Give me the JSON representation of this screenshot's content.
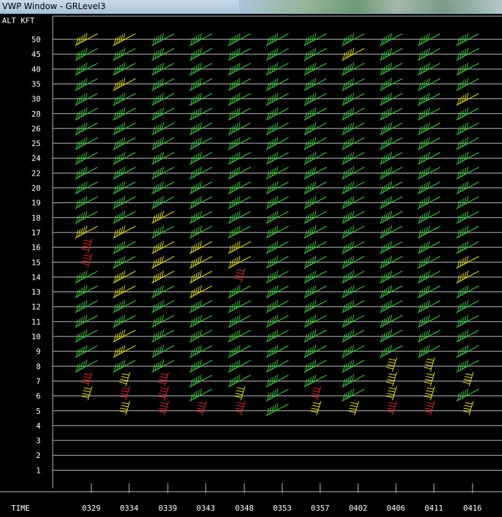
{
  "window": {
    "title": "VWP Window - GRLevel3"
  },
  "axis": {
    "alt_label": "ALT KFT",
    "time_label": "TIME",
    "altitudes": [
      "50",
      "45",
      "40",
      "35",
      "30",
      "28",
      "26",
      "25",
      "24",
      "22",
      "20",
      "19",
      "18",
      "17",
      "16",
      "15",
      "14",
      "13",
      "12",
      "11",
      "10",
      "9",
      "8",
      "7",
      "6",
      "5",
      "4",
      "3",
      "2",
      "1"
    ],
    "times": [
      "0329",
      "0334",
      "0339",
      "0343",
      "0348",
      "0353",
      "0357",
      "0402",
      "0406",
      "0411",
      "0416"
    ]
  },
  "colors": {
    "green": "#3fd23f",
    "yellow": "#e8e21e",
    "red": "#e02a2a",
    "grid": "#bfbfbf",
    "text": "#ffffff"
  },
  "barb_grid": {
    "rows": [
      "35",
      "30",
      "28",
      "26",
      "25",
      "24",
      "22",
      "20",
      "19",
      "18",
      "17",
      "16",
      "15",
      "14",
      "13",
      "12",
      "11",
      "10",
      "9",
      "8",
      "7",
      "6",
      "5",
      "4",
      "3",
      "2"
    ],
    "columns": [
      "YGGGGGGGGGGGGYRRGGGGGGGRY",
      "YGGYGGGGGGGGGYGGYYGGYYGYRY",
      "GGGGGGGGGGGGYGYYYGGGGGGRRR",
      "GGGGGGGGGGGGGGYYYYGGGGGGGR",
      "GGGGGGGGGGGGGGYYRGGGGGGGYR",
      "GGGGGGGGGGGGGGGGGGGGGGGGGG",
      "GGGGGGGGGGGGGGGGGGGGGGGGRY",
      "GYGGGGGGGGGGGGGGGGGGGGGGGY",
      "GGGGGGGGGGGGGGGGGGGGGGYYYR",
      "GGGGGGGGGGGGGGGGGGGGGGYYYR",
      "GGGGYGGGGGGGGGGYYGGGGGGYGY"
    ]
  }
}
